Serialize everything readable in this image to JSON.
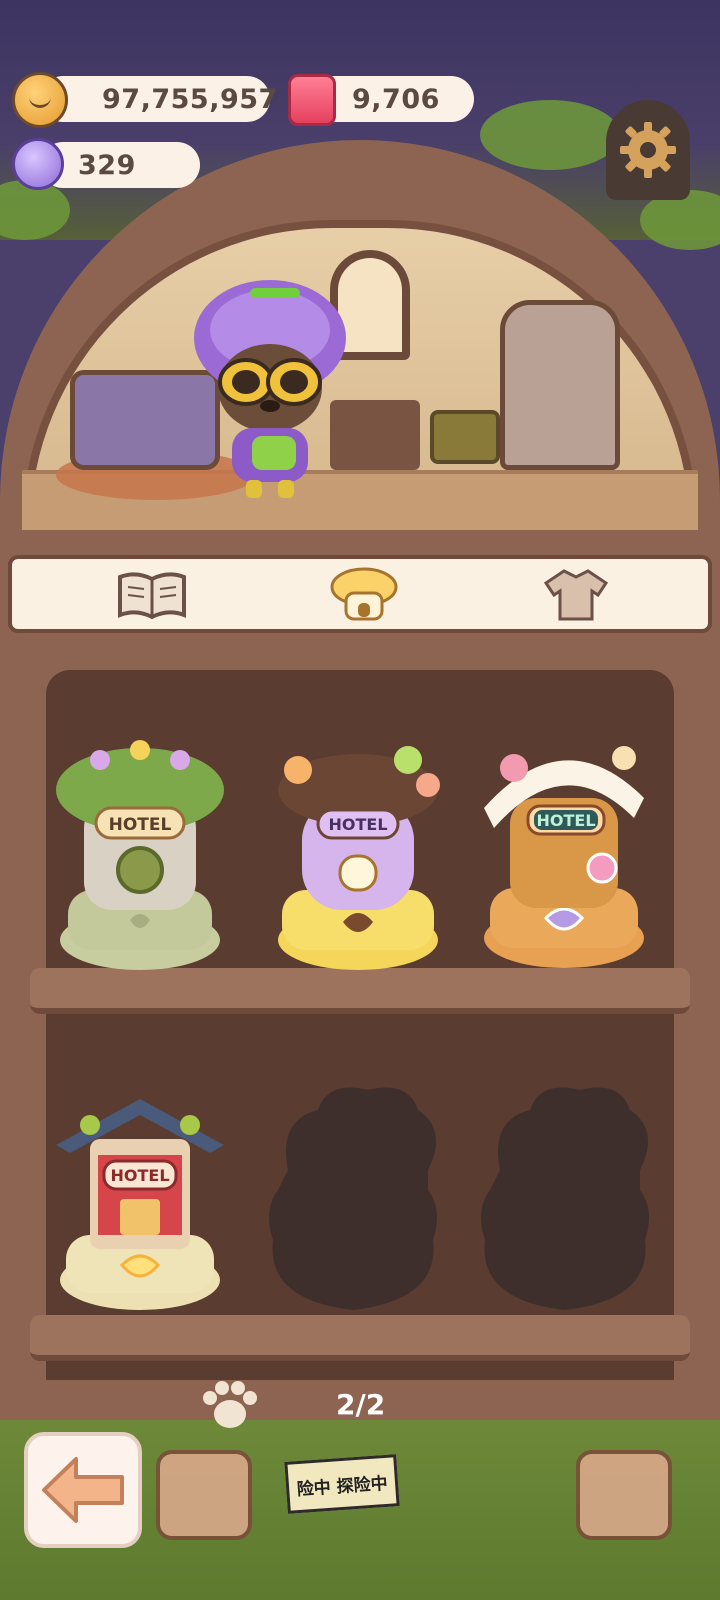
{
  "currencies": {
    "coins": "97,755,957",
    "gems": "9,706",
    "crystals": "329"
  },
  "icons": {
    "coin": "cookie-coin-icon",
    "gem": "pink-jelly-gem-icon",
    "crystal": "candy-crystal-icon",
    "settings": "gear-icon",
    "tab_book": "book-icon",
    "tab_house": "mushroom-house-icon",
    "tab_clothes": "shirt-icon",
    "paw": "paw-icon",
    "back": "arrow-left-icon"
  },
  "tabs": [
    {
      "name": "catalog",
      "active": false
    },
    {
      "name": "hotels",
      "active": true
    },
    {
      "name": "outfits",
      "active": false
    }
  ],
  "shelf": {
    "row1": [
      {
        "label": "HOTEL",
        "theme": "forest",
        "color": "#7ea94a"
      },
      {
        "label": "HOTEL",
        "theme": "mushroom",
        "color": "#e0c3f0"
      },
      {
        "label": "HOTEL",
        "theme": "candy",
        "color": "#e9a35c"
      }
    ],
    "row2": [
      {
        "label": "HOTEL",
        "theme": "temple",
        "color": "#c8474a"
      },
      {
        "label": "",
        "theme": "locked"
      },
      {
        "label": "",
        "theme": "locked"
      }
    ]
  },
  "pagination": "2/2",
  "bottom_bar": {
    "tape_text": "险中 探险中"
  },
  "colors": {
    "wood": "#8d6452",
    "shelf": "#9e735e",
    "pill_bg": "#fbf1e6",
    "text": "#5b4a43"
  }
}
